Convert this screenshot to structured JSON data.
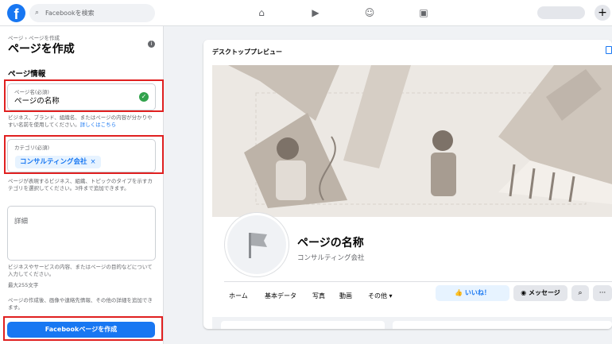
{
  "topbar": {
    "logo": "f",
    "search_placeholder": "Facebookを検索",
    "plus": "+"
  },
  "sidebar": {
    "breadcrumb": "ページ › ページを作成",
    "title": "ページを作成",
    "info_icon": "i",
    "section_title": "ページ情報",
    "name_field": {
      "label": "ページ名(必須)",
      "value": "ページの名称"
    },
    "name_help": "ビジネス、ブランド、組織名、またはページの内容が分かりやすい名前を使用してください。",
    "name_help_link": "詳しくはこちら",
    "category_field": {
      "label": "カテゴリ(必須)",
      "chip": "コンサルティング会社",
      "chip_remove": "×"
    },
    "category_help": "ページが表現するビジネス、組織、トピックのタイプを示すカテゴリを選択してください。3件まで追加できます。",
    "detail_placeholder": "詳細",
    "detail_help": "ビジネスやサービスの内容、またはページの目的などについて入力してください。",
    "detail_limit": "最大255文字",
    "terms": "ページの作成後、画像や連絡先情報、その他の詳細を追加できます。",
    "create_button": "Facebookページを作成"
  },
  "preview": {
    "title": "デスクトッププレビュー",
    "page_name": "ページの名称",
    "page_category": "コンサルティング会社",
    "tabs": [
      "ホーム",
      "基本データ",
      "写真",
      "動画",
      "その他 ▾"
    ],
    "like_button": "👍 いいね！",
    "message_button": "メッセージ",
    "search_icon": "⌕",
    "more_icon": "···"
  },
  "colors": {
    "accent": "#1877f2",
    "highlight": "#e02020",
    "success": "#31a24c"
  }
}
